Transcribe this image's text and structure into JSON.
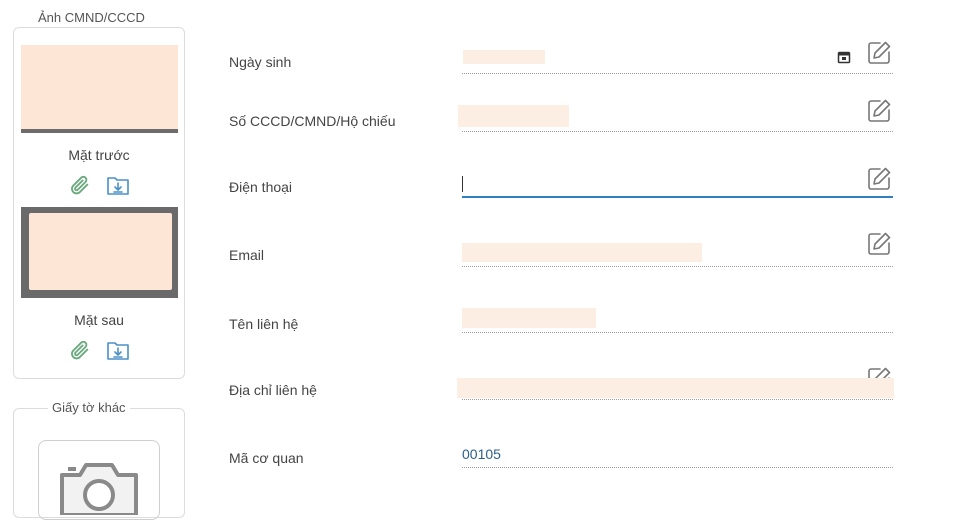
{
  "id_card": {
    "title": "Ảnh CMND/CCCD",
    "front_label": "Mặt trước",
    "back_label": "Mặt sau"
  },
  "other_docs": {
    "title": "Giấy tờ khác"
  },
  "form": {
    "dob_label": "Ngày sinh",
    "id_number_label": "Số CCCD/CMND/Hộ chiếu",
    "phone_label": "Điện thoại",
    "email_label": "Email",
    "contact_name_label": "Tên liên hệ",
    "contact_address_label": "Địa chỉ liên hệ",
    "agency_code_label": "Mã cơ quan",
    "agency_code_value": "00105"
  },
  "icons": {
    "attach": "paperclip-icon",
    "download": "folder-download-icon",
    "edit": "edit-icon",
    "calendar": "calendar-icon",
    "camera": "camera-icon"
  },
  "colors": {
    "accent": "#2f7fc1",
    "icon_green": "#6aaa7e",
    "icon_blue": "#4a90c8",
    "redacted": "#fdeee3"
  }
}
